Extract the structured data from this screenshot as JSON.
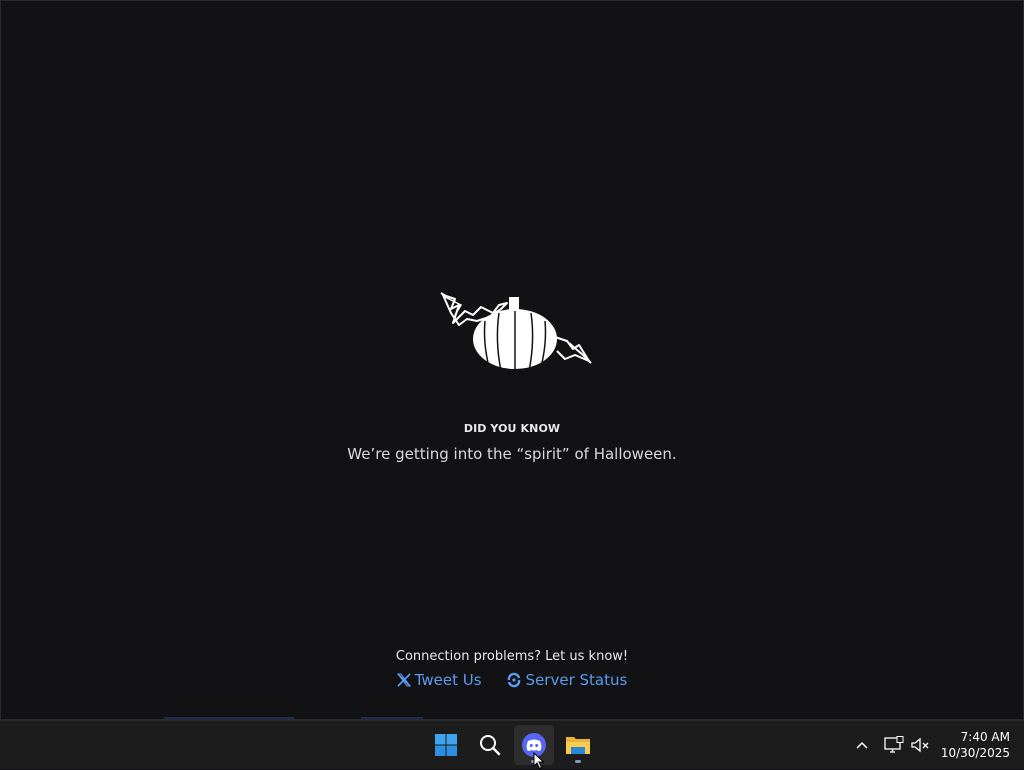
{
  "splash": {
    "tip_title": "DID YOU KNOW",
    "tip_text": "We’re getting into the “spirit” of Halloween.",
    "connection_text": "Connection problems? Let us know!",
    "tweet_label": "Tweet Us",
    "status_label": "Server Status"
  },
  "taskbar": {
    "apps": [
      {
        "name": "Start",
        "icon": "windows-logo-icon"
      },
      {
        "name": "Search",
        "icon": "search-icon"
      },
      {
        "name": "Discord",
        "icon": "discord-icon",
        "active": true
      },
      {
        "name": "File Explorer",
        "icon": "folder-icon"
      }
    ],
    "time": "7:40 AM",
    "date": "10/30/2025"
  },
  "colors": {
    "background": "#121214",
    "link": "#5b9cf0",
    "discord_blurple": "#5865f2",
    "taskbar": "#1c1c1c"
  }
}
